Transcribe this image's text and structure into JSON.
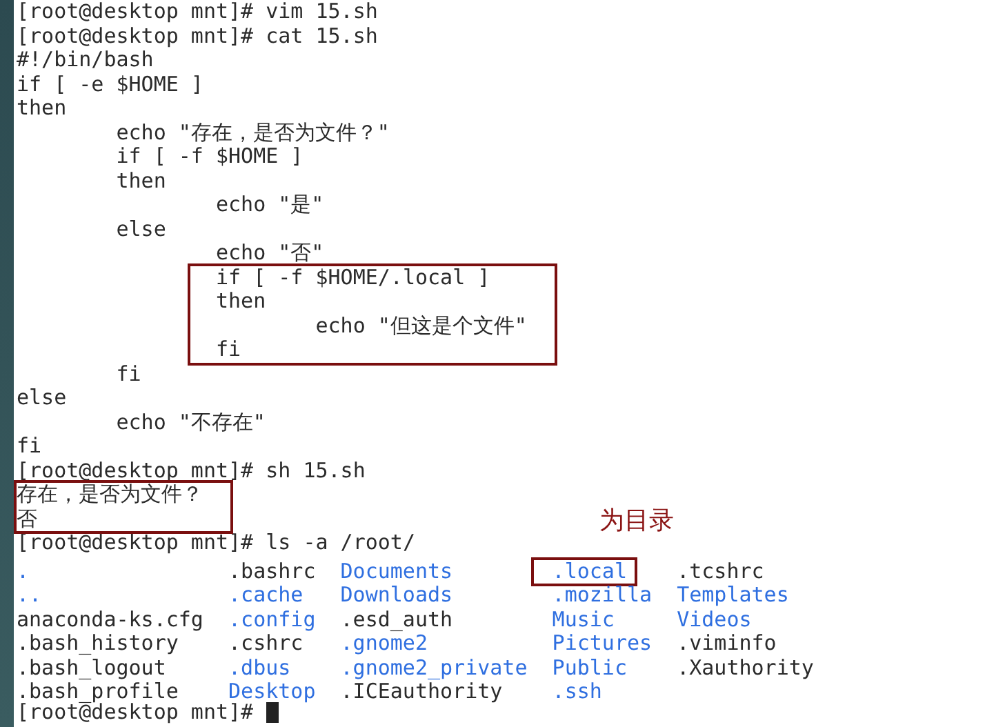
{
  "lines": [
    {
      "text": "[root@desktop mnt]# vim 15.sh",
      "framed": false
    },
    {
      "text": "[root@desktop mnt]# cat 15.sh",
      "framed": false
    },
    {
      "text": "#!/bin/bash",
      "framed": false
    },
    {
      "text": "if [ -e $HOME ]",
      "framed": false
    },
    {
      "text": "then",
      "framed": false
    },
    {
      "text": "        echo \"存在，是否为文件？\"",
      "framed": false
    },
    {
      "text": "        if [ -f $HOME ]",
      "framed": false
    },
    {
      "text": "        then",
      "framed": false
    },
    {
      "text": "                echo \"是\"",
      "framed": false
    },
    {
      "text": "        else",
      "framed": false
    },
    {
      "text": "                echo \"否\"",
      "framed": false
    },
    {
      "text": "                if [ -f $HOME/.local ]",
      "framed": true
    },
    {
      "text": "                then",
      "framed": true
    },
    {
      "text": "                        echo \"但这是个文件\"",
      "framed": true
    },
    {
      "text": "                fi",
      "framed": true
    },
    {
      "text": "        fi",
      "framed": false
    },
    {
      "text": "else",
      "framed": false
    },
    {
      "text": "        echo \"不存在\"",
      "framed": false
    },
    {
      "text": "fi",
      "framed": false
    },
    {
      "text": "[root@desktop mnt]# sh 15.sh",
      "framed": false
    },
    {
      "text": "存在，是否为文件？",
      "framed": true
    },
    {
      "text": "否",
      "framed": true
    },
    {
      "text": "[root@desktop mnt]# ls -a /root/",
      "framed": false
    }
  ],
  "listing": [
    [
      {
        "name": ".",
        "kind": "dir"
      },
      {
        "name": ".bashrc",
        "kind": "file"
      },
      {
        "name": "Documents",
        "kind": "dir"
      },
      {
        "name": ".local",
        "kind": "dir",
        "framed": true,
        "note": "为目录"
      },
      {
        "name": ".tcshrc",
        "kind": "file"
      }
    ],
    [
      {
        "name": "..",
        "kind": "dir"
      },
      {
        "name": ".cache",
        "kind": "dir"
      },
      {
        "name": "Downloads",
        "kind": "dir"
      },
      {
        "name": ".mozilla",
        "kind": "dir"
      },
      {
        "name": "Templates",
        "kind": "dir"
      }
    ],
    [
      {
        "name": "anaconda-ks.cfg",
        "kind": "file"
      },
      {
        "name": ".config",
        "kind": "dir"
      },
      {
        "name": ".esd_auth",
        "kind": "file"
      },
      {
        "name": "Music",
        "kind": "dir"
      },
      {
        "name": "Videos",
        "kind": "dir"
      }
    ],
    [
      {
        "name": ".bash_history",
        "kind": "file"
      },
      {
        "name": ".cshrc",
        "kind": "file"
      },
      {
        "name": ".gnome2",
        "kind": "dir"
      },
      {
        "name": "Pictures",
        "kind": "dir"
      },
      {
        "name": ".viminfo",
        "kind": "file"
      }
    ],
    [
      {
        "name": ".bash_logout",
        "kind": "file"
      },
      {
        "name": ".dbus",
        "kind": "dir"
      },
      {
        "name": ".gnome2_private",
        "kind": "dir"
      },
      {
        "name": "Public",
        "kind": "dir"
      },
      {
        "name": ".Xauthority",
        "kind": "file"
      }
    ],
    [
      {
        "name": ".bash_profile",
        "kind": "file"
      },
      {
        "name": "Desktop",
        "kind": "dir"
      },
      {
        "name": ".ICEauthority",
        "kind": "file"
      },
      {
        "name": ".ssh",
        "kind": "dir"
      }
    ]
  ],
  "prompt": "[root@desktop mnt]#"
}
